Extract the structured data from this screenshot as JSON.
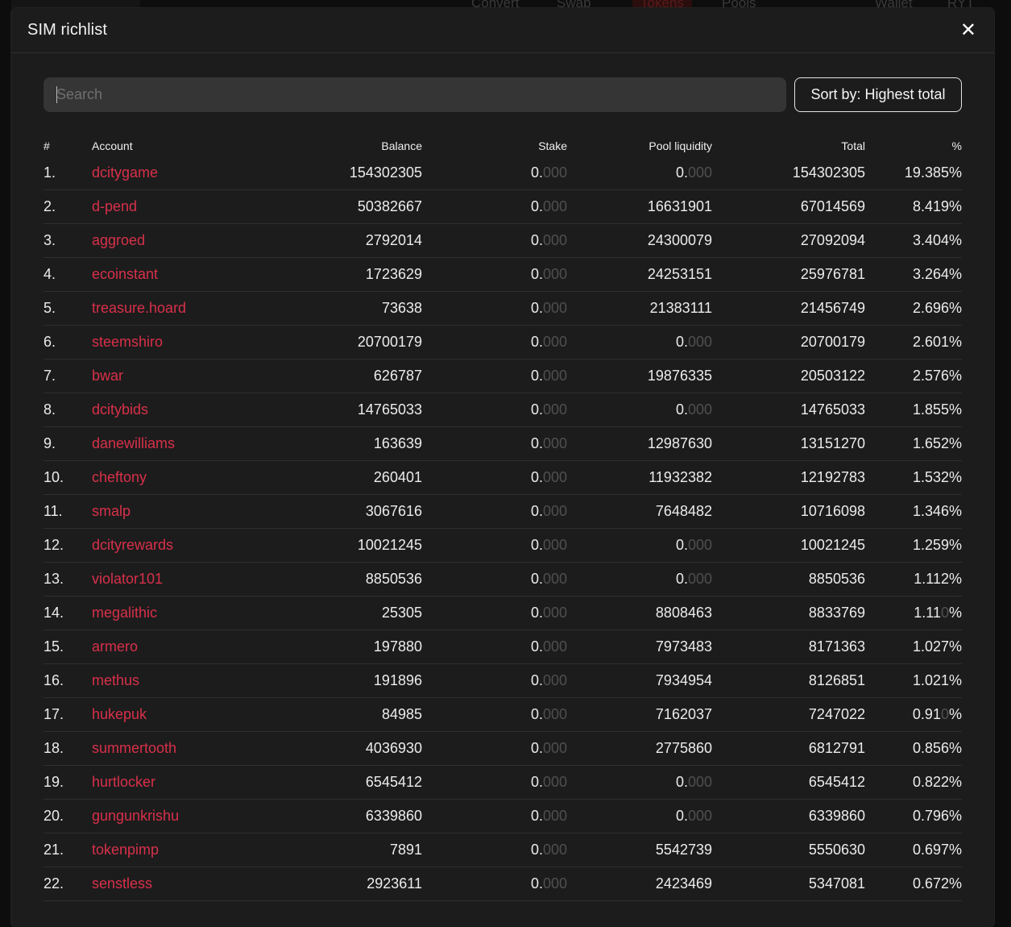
{
  "background_nav": {
    "items": [
      "Convert",
      "Swap",
      "Tokens",
      "Pools",
      "Wallet",
      "RYT"
    ]
  },
  "modal": {
    "title": "SIM richlist",
    "close_icon": "close-icon"
  },
  "search": {
    "placeholder": "Search",
    "value": ""
  },
  "sort": {
    "label": "Sort by: Highest total"
  },
  "table": {
    "headers": [
      "#",
      "Account",
      "Balance",
      "Stake",
      "Pool liquidity",
      "Total",
      "%"
    ],
    "rows": [
      {
        "rank": "1.",
        "account": "dcitygame",
        "balance": "154302305",
        "stake_int": "0.",
        "stake_dec": "000",
        "pool_int": "0.",
        "pool_dec": "000",
        "total": "154302305",
        "pct_main": "19.385",
        "pct_dim": "",
        "pct_sign": "%"
      },
      {
        "rank": "2.",
        "account": "d-pend",
        "balance": "50382667",
        "stake_int": "0.",
        "stake_dec": "000",
        "pool_int": "16631901",
        "pool_dec": "",
        "total": "67014569",
        "pct_main": "8.419",
        "pct_dim": "",
        "pct_sign": "%"
      },
      {
        "rank": "3.",
        "account": "aggroed",
        "balance": "2792014",
        "stake_int": "0.",
        "stake_dec": "000",
        "pool_int": "24300079",
        "pool_dec": "",
        "total": "27092094",
        "pct_main": "3.404",
        "pct_dim": "",
        "pct_sign": "%"
      },
      {
        "rank": "4.",
        "account": "ecoinstant",
        "balance": "1723629",
        "stake_int": "0.",
        "stake_dec": "000",
        "pool_int": "24253151",
        "pool_dec": "",
        "total": "25976781",
        "pct_main": "3.264",
        "pct_dim": "",
        "pct_sign": "%"
      },
      {
        "rank": "5.",
        "account": "treasure.hoard",
        "balance": "73638",
        "stake_int": "0.",
        "stake_dec": "000",
        "pool_int": "21383111",
        "pool_dec": "",
        "total": "21456749",
        "pct_main": "2.696",
        "pct_dim": "",
        "pct_sign": "%"
      },
      {
        "rank": "6.",
        "account": "steemshiro",
        "balance": "20700179",
        "stake_int": "0.",
        "stake_dec": "000",
        "pool_int": "0.",
        "pool_dec": "000",
        "total": "20700179",
        "pct_main": "2.601",
        "pct_dim": "",
        "pct_sign": "%"
      },
      {
        "rank": "7.",
        "account": "bwar",
        "balance": "626787",
        "stake_int": "0.",
        "stake_dec": "000",
        "pool_int": "19876335",
        "pool_dec": "",
        "total": "20503122",
        "pct_main": "2.576",
        "pct_dim": "",
        "pct_sign": "%"
      },
      {
        "rank": "8.",
        "account": "dcitybids",
        "balance": "14765033",
        "stake_int": "0.",
        "stake_dec": "000",
        "pool_int": "0.",
        "pool_dec": "000",
        "total": "14765033",
        "pct_main": "1.855",
        "pct_dim": "",
        "pct_sign": "%"
      },
      {
        "rank": "9.",
        "account": "danewilliams",
        "balance": "163639",
        "stake_int": "0.",
        "stake_dec": "000",
        "pool_int": "12987630",
        "pool_dec": "",
        "total": "13151270",
        "pct_main": "1.652",
        "pct_dim": "",
        "pct_sign": "%"
      },
      {
        "rank": "10.",
        "account": "cheftony",
        "balance": "260401",
        "stake_int": "0.",
        "stake_dec": "000",
        "pool_int": "11932382",
        "pool_dec": "",
        "total": "12192783",
        "pct_main": "1.532",
        "pct_dim": "",
        "pct_sign": "%"
      },
      {
        "rank": "11.",
        "account": "smalp",
        "balance": "3067616",
        "stake_int": "0.",
        "stake_dec": "000",
        "pool_int": "7648482",
        "pool_dec": "",
        "total": "10716098",
        "pct_main": "1.346",
        "pct_dim": "",
        "pct_sign": "%"
      },
      {
        "rank": "12.",
        "account": "dcityrewards",
        "balance": "10021245",
        "stake_int": "0.",
        "stake_dec": "000",
        "pool_int": "0.",
        "pool_dec": "000",
        "total": "10021245",
        "pct_main": "1.259",
        "pct_dim": "",
        "pct_sign": "%"
      },
      {
        "rank": "13.",
        "account": "violator101",
        "balance": "8850536",
        "stake_int": "0.",
        "stake_dec": "000",
        "pool_int": "0.",
        "pool_dec": "000",
        "total": "8850536",
        "pct_main": "1.112",
        "pct_dim": "",
        "pct_sign": "%"
      },
      {
        "rank": "14.",
        "account": "megalithic",
        "balance": "25305",
        "stake_int": "0.",
        "stake_dec": "000",
        "pool_int": "8808463",
        "pool_dec": "",
        "total": "8833769",
        "pct_main": "1.11",
        "pct_dim": "0",
        "pct_sign": "%"
      },
      {
        "rank": "15.",
        "account": "armero",
        "balance": "197880",
        "stake_int": "0.",
        "stake_dec": "000",
        "pool_int": "7973483",
        "pool_dec": "",
        "total": "8171363",
        "pct_main": "1.027",
        "pct_dim": "",
        "pct_sign": "%"
      },
      {
        "rank": "16.",
        "account": "methus",
        "balance": "191896",
        "stake_int": "0.",
        "stake_dec": "000",
        "pool_int": "7934954",
        "pool_dec": "",
        "total": "8126851",
        "pct_main": "1.021",
        "pct_dim": "",
        "pct_sign": "%"
      },
      {
        "rank": "17.",
        "account": "hukepuk",
        "balance": "84985",
        "stake_int": "0.",
        "stake_dec": "000",
        "pool_int": "7162037",
        "pool_dec": "",
        "total": "7247022",
        "pct_main": "0.91",
        "pct_dim": "0",
        "pct_sign": "%"
      },
      {
        "rank": "18.",
        "account": "summertooth",
        "balance": "4036930",
        "stake_int": "0.",
        "stake_dec": "000",
        "pool_int": "2775860",
        "pool_dec": "",
        "total": "6812791",
        "pct_main": "0.856",
        "pct_dim": "",
        "pct_sign": "%"
      },
      {
        "rank": "19.",
        "account": "hurtlocker",
        "balance": "6545412",
        "stake_int": "0.",
        "stake_dec": "000",
        "pool_int": "0.",
        "pool_dec": "000",
        "total": "6545412",
        "pct_main": "0.822",
        "pct_dim": "",
        "pct_sign": "%"
      },
      {
        "rank": "20.",
        "account": "gungunkrishu",
        "balance": "6339860",
        "stake_int": "0.",
        "stake_dec": "000",
        "pool_int": "0.",
        "pool_dec": "000",
        "total": "6339860",
        "pct_main": "0.796",
        "pct_dim": "",
        "pct_sign": "%"
      },
      {
        "rank": "21.",
        "account": "tokenpimp",
        "balance": "7891",
        "stake_int": "0.",
        "stake_dec": "000",
        "pool_int": "5542739",
        "pool_dec": "",
        "total": "5550630",
        "pct_main": "0.697",
        "pct_dim": "",
        "pct_sign": "%"
      },
      {
        "rank": "22.",
        "account": "senstless",
        "balance": "2923611",
        "stake_int": "0.",
        "stake_dec": "000",
        "pool_int": "2423469",
        "pool_dec": "",
        "total": "5347081",
        "pct_main": "0.672",
        "pct_dim": "",
        "pct_sign": "%"
      }
    ]
  },
  "colors": {
    "accent_link": "#d8304a",
    "modal_bg": "#1c1c1c",
    "dim_text": "#4f4f4f"
  }
}
